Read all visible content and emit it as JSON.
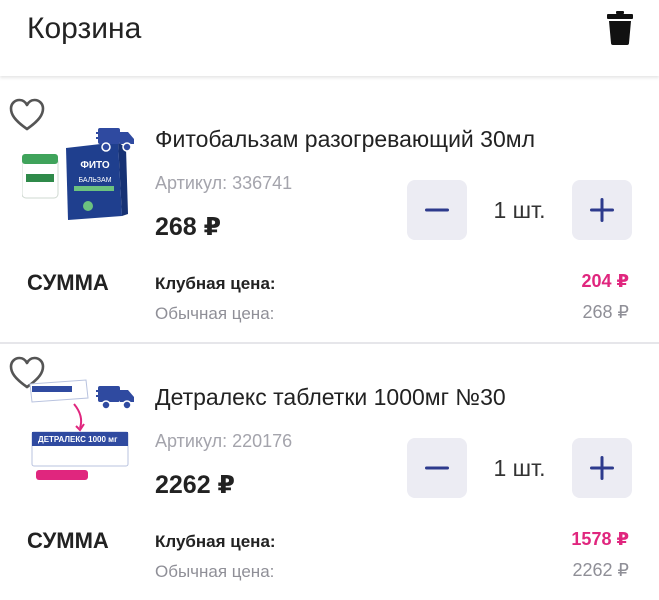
{
  "header": {
    "title": "Корзина",
    "trash_icon": "trash-icon"
  },
  "colors": {
    "accent": "#e0267e",
    "button_bg": "#ececf3",
    "button_icon": "#2d3a8c",
    "muted": "#8f8f97"
  },
  "items": [
    {
      "name": "Фитобальзам разогревающий 30мл",
      "sku": "Артикул: 336741",
      "price": "268 ₽",
      "quantity": "1 шт.",
      "sum_label": "СУММА",
      "club_price_label": "Клубная цена:",
      "club_price": "204 ₽",
      "regular_price_label": "Обычная цена:",
      "regular_price": "268 ₽",
      "delivery_icon": "truck-icon",
      "favorite_icon": "heart-icon",
      "package_text": "ФИТО БАЛЬЗАМ"
    },
    {
      "name": "Детралекс таблетки 1000мг №30",
      "sku": "Артикул: 220176",
      "price": "2262 ₽",
      "quantity": "1 шт.",
      "sum_label": "СУММА",
      "club_price_label": "Клубная цена:",
      "club_price": "1578 ₽",
      "regular_price_label": "Обычная цена:",
      "regular_price": "2262 ₽",
      "delivery_icon": "truck-icon",
      "favorite_icon": "heart-icon",
      "package_text": "ДЕТРАЛЕКС 1000 мг"
    }
  ]
}
